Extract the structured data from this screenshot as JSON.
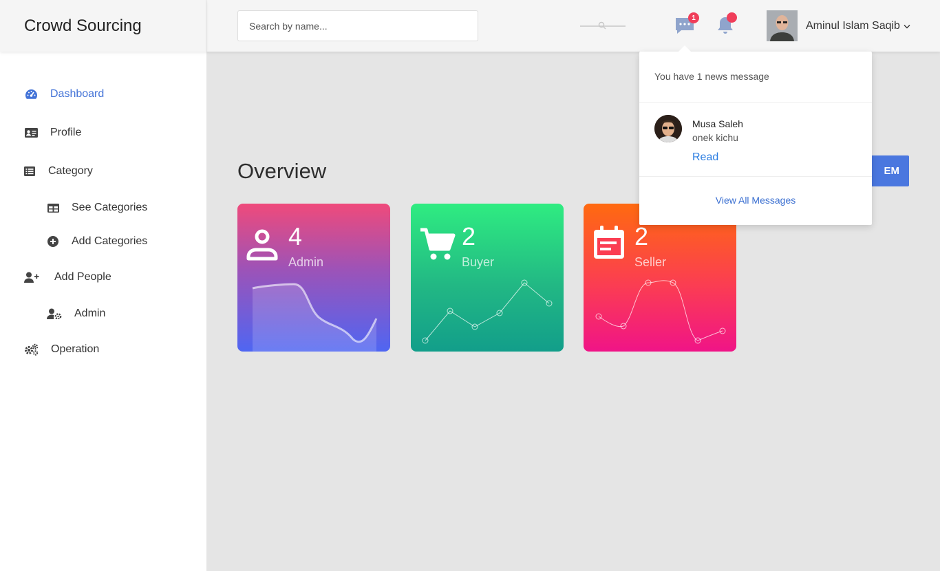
{
  "brand": {
    "title": "Crowd Sourcing"
  },
  "sidebar": {
    "items": [
      {
        "label": "Dashboard",
        "icon": "dashboard-icon",
        "active": true
      },
      {
        "label": "Profile",
        "icon": "id-card-icon"
      },
      {
        "label": "Category",
        "icon": "list-icon"
      },
      {
        "label": "See Categories",
        "icon": "table-icon"
      },
      {
        "label": "Add Categories",
        "icon": "plus-circle-icon"
      },
      {
        "label": "Add People",
        "icon": "user-plus-icon"
      },
      {
        "label": "Admin",
        "icon": "user-cog-icon"
      },
      {
        "label": "Operation",
        "icon": "cogs-icon"
      }
    ]
  },
  "header": {
    "search_placeholder": "Search by name...",
    "message_count": "1",
    "user_name": "Aminul Islam Saqib"
  },
  "main": {
    "title": "Overview",
    "action_label": "EM",
    "cards": [
      {
        "value": "4",
        "label": "Admin",
        "icon": "user-icon"
      },
      {
        "value": "2",
        "label": "Buyer",
        "icon": "cart-icon"
      },
      {
        "value": "2",
        "label": "Seller",
        "icon": "calendar-icon"
      }
    ]
  },
  "dropdown": {
    "header": "You have 1 news message",
    "sender": "Musa Saleh",
    "message": "onek kichu",
    "read_label": "Read",
    "view_all_label": "View All Messages"
  },
  "colors": {
    "accent": "#4272d7",
    "badge": "#f03e5a",
    "admin_card": [
      "#ef4a7b",
      "#4f66f2"
    ],
    "buyer_card": [
      "#2fec81",
      "#129e8a"
    ],
    "seller_card": [
      "#ff6a10",
      "#f01487"
    ]
  }
}
